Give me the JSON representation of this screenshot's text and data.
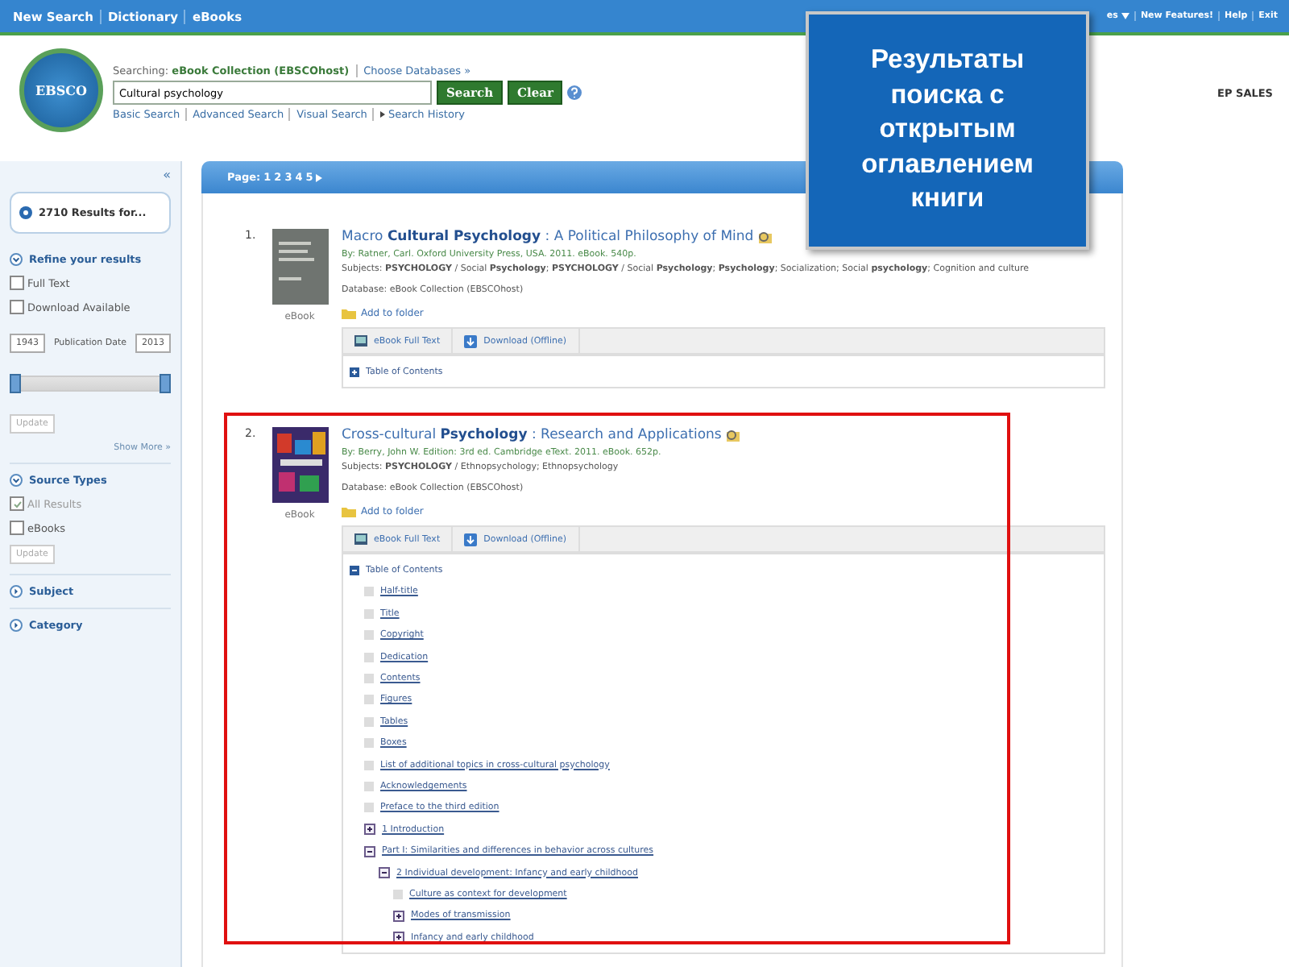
{
  "top_nav": {
    "left": [
      "New Search",
      "Dictionary",
      "eBooks"
    ],
    "right": [
      {
        "label": "es",
        "menu": true
      },
      {
        "label": "New Features!",
        "menu": false
      },
      {
        "label": "Help",
        "menu": false
      },
      {
        "label": "Exit",
        "menu": false
      }
    ]
  },
  "header": {
    "logo_text": "EBSCO",
    "searching_label": "Searching:",
    "database": "eBook Collection (EBSCOhost)",
    "choose_link": "Choose Databases »",
    "query": "Cultural psychology",
    "buttons": [
      "Search",
      "Clear"
    ],
    "links": [
      {
        "label": "Basic Search",
        "arrow": false
      },
      {
        "label": "Advanced Search",
        "arrow": false
      },
      {
        "label": "Visual Search",
        "arrow": false
      },
      {
        "label": "Search History",
        "arrow": true
      }
    ],
    "account": "EP SALES"
  },
  "sidebar": {
    "collapse": "«",
    "results": "2710 Results for...",
    "sections": [
      {
        "kind": "refine",
        "title": "Refine your results",
        "expanded": true,
        "options": [
          {
            "label": "Full Text",
            "checked": false
          },
          {
            "label": "Download Available",
            "checked": false
          }
        ],
        "date_from": "1943",
        "date_label": "Publication Date",
        "date_to": "2013",
        "slider": {
          "level": 1
        },
        "update": "Update",
        "more": "Show More »"
      },
      {
        "kind": "source",
        "title": "Source Types",
        "expanded": true,
        "options": [
          {
            "label": "All Results",
            "checked": true
          },
          {
            "label": "eBooks",
            "checked": false
          }
        ],
        "update": "Update"
      },
      {
        "kind": "facet",
        "title": "Subject",
        "expanded": false
      },
      {
        "kind": "facet",
        "title": "Category",
        "expanded": false
      }
    ]
  },
  "results": {
    "pager_label": "Page:",
    "pages": [
      "1",
      "2",
      "3",
      "4",
      "5"
    ],
    "items": [
      {
        "number": "1.",
        "type": "eBook",
        "kind": "plain",
        "highlighted": false,
        "title": "Macro **Cultural Psychology** : A Political Philosophy of Mind",
        "by": "By: Ratner, Carl. Oxford University Press, USA. 2011. eBook. 540p.",
        "subjects": "Subjects: **PSYCHOLOGY** / Social **Psychology**; **PSYCHOLOGY** / Social **Psychology**; **Psychology**; Socialization; Social **psychology**; Cognition and culture",
        "database": "Database: eBook Collection (EBSCOhost)",
        "folder": "Add to folder",
        "actions": [
          "eBook Full Text",
          "Download (Offline)"
        ],
        "toc": {
          "label": "Table of Contents",
          "expanded": false
        }
      },
      {
        "number": "2.",
        "type": "eBook",
        "kind": "colorful",
        "highlighted": true,
        "title": "Cross-cultural **Psychology** : Research and Applications",
        "by": "By: Berry, John W. Edition: 3rd ed. Cambridge eText. 2011. eBook. 652p.",
        "subjects": "Subjects: **PSYCHOLOGY** / Ethnopsychology; Ethnopsychology",
        "database": "Database: eBook Collection (EBSCOhost)",
        "folder": "Add to folder",
        "actions": [
          "eBook Full Text",
          "Download (Offline)"
        ],
        "toc": {
          "label": "Table of Contents",
          "expanded": true,
          "children": [
            {
              "kind": "page",
              "label": "Half-title"
            },
            {
              "kind": "page",
              "label": "Title"
            },
            {
              "kind": "page",
              "label": "Copyright"
            },
            {
              "kind": "page",
              "label": "Dedication"
            },
            {
              "kind": "page",
              "label": "Contents"
            },
            {
              "kind": "page",
              "label": "Figures"
            },
            {
              "kind": "page",
              "label": "Tables"
            },
            {
              "kind": "page",
              "label": "Boxes"
            },
            {
              "kind": "page",
              "label": "List of additional topics in cross-cultural psychology"
            },
            {
              "kind": "page",
              "label": "Acknowledgements"
            },
            {
              "kind": "page",
              "label": "Preface to the third edition"
            },
            {
              "kind": "section",
              "label": "1 Introduction",
              "expanded": false
            },
            {
              "kind": "section",
              "label": "Part I: Similarities and differences in behavior across cultures",
              "expanded": true,
              "children": [
                {
                  "kind": "section",
                  "label": "2 Individual development: Infancy and early childhood",
                  "expanded": true,
                  "children": [
                    {
                      "kind": "page",
                      "label": "Culture as context for development"
                    },
                    {
                      "kind": "section",
                      "label": "Modes of transmission",
                      "expanded": false
                    },
                    {
                      "kind": "section",
                      "label": "Infancy and early childhood",
                      "expanded": false
                    }
                  ]
                }
              ]
            }
          ]
        }
      }
    ]
  },
  "callout": {
    "text": "Результаты поиска с открытым оглавлением книги"
  }
}
